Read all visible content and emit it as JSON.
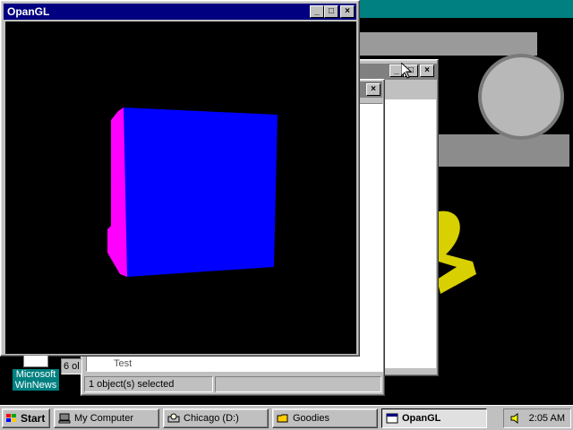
{
  "opengl_window": {
    "title": "OpanGL"
  },
  "explorer_window": {
    "file_item": "Test",
    "status_count": "1 object(s) selected",
    "side_fragment": "6 ol"
  },
  "desktop": {
    "icon_label": "Microsoft WinNews"
  },
  "taskbar": {
    "start_label": "Start",
    "tasks": [
      {
        "label": "My Computer"
      },
      {
        "label": "Chicago (D:)"
      },
      {
        "label": "Goodies"
      },
      {
        "label": "OpanGL"
      }
    ],
    "clock": "2:05 AM"
  },
  "colors": {
    "titlebar_active": "#000080",
    "desktop_teal": "#008080",
    "cube_front": "#0000ff",
    "cube_side": "#ff00ff"
  }
}
